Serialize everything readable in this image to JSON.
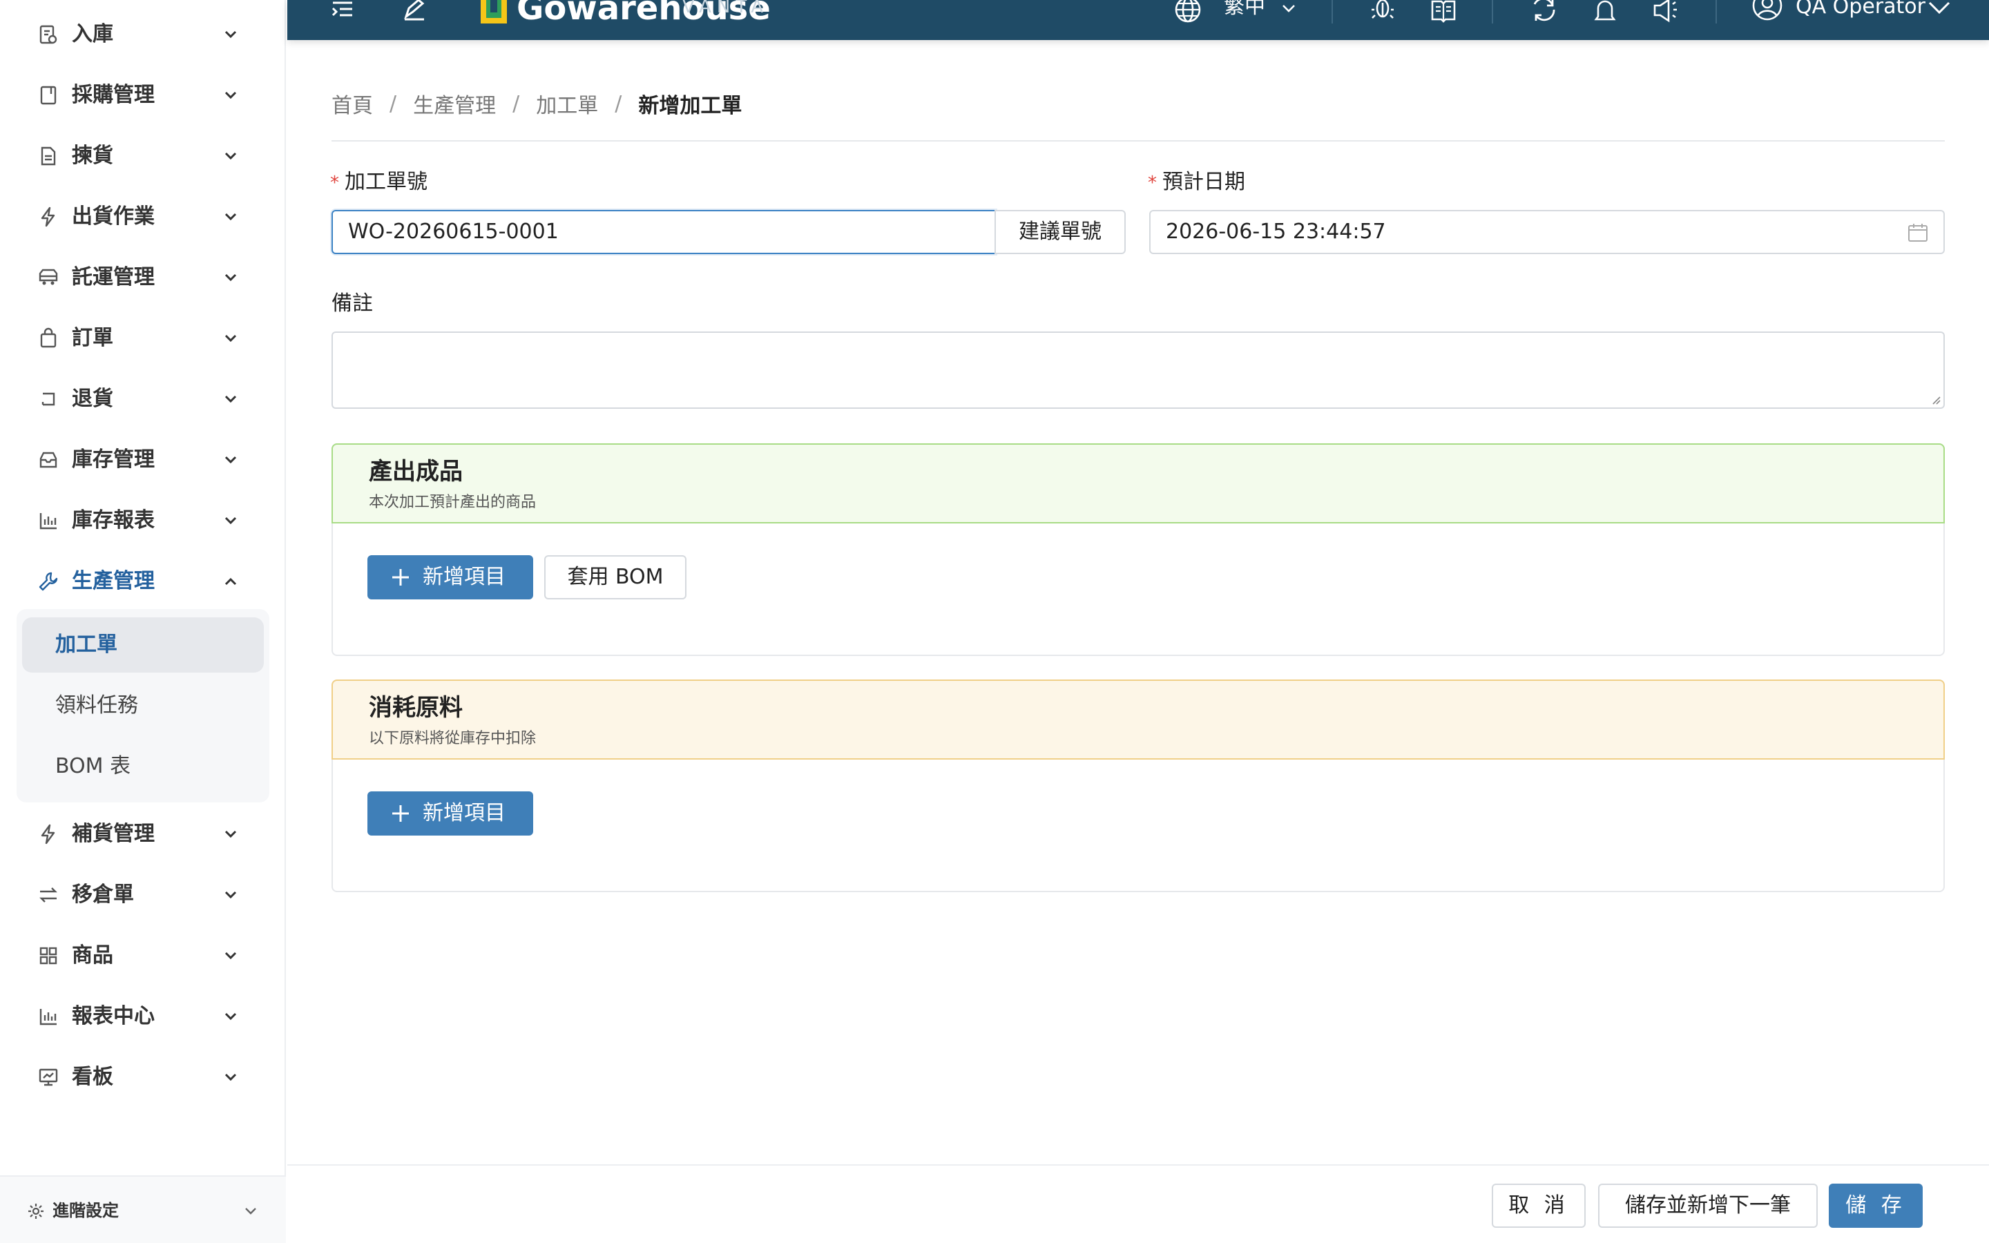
{
  "header": {
    "brand_name": "Gowarehouse",
    "brand_sub": "VANTA",
    "language": "繁中",
    "user": "QA Operator",
    "icons": [
      "menu-toggle-icon",
      "edit-icon",
      "globe-icon",
      "bug-icon",
      "book-icon",
      "refresh-icon",
      "bell-icon",
      "megaphone-icon",
      "user-icon"
    ]
  },
  "sidebar": {
    "items": [
      {
        "label": "入庫",
        "icon": "inbound-icon"
      },
      {
        "label": "採購管理",
        "icon": "purchase-icon"
      },
      {
        "label": "揀貨",
        "icon": "picking-icon"
      },
      {
        "label": "出貨作業",
        "icon": "lightning-icon"
      },
      {
        "label": "託運管理",
        "icon": "truck-icon"
      },
      {
        "label": "訂單",
        "icon": "bag-icon"
      },
      {
        "label": "退貨",
        "icon": "return-icon"
      },
      {
        "label": "庫存管理",
        "icon": "inbox-icon"
      },
      {
        "label": "庫存報表",
        "icon": "bar-chart-icon"
      },
      {
        "label": "生產管理",
        "icon": "wrench-icon"
      },
      {
        "label": "補貨管理",
        "icon": "lightning-icon"
      },
      {
        "label": "移倉單",
        "icon": "transfer-icon"
      },
      {
        "label": "商品",
        "icon": "grid-icon"
      },
      {
        "label": "報表中心",
        "icon": "bar-chart-icon"
      },
      {
        "label": "看板",
        "icon": "dashboard-icon"
      }
    ],
    "submenu": [
      {
        "label": "加工單"
      },
      {
        "label": "領料任務"
      },
      {
        "label": "BOM 表"
      }
    ],
    "footer_label": "進階設定"
  },
  "breadcrumb": {
    "items": [
      "首頁",
      "生產管理",
      "加工單"
    ],
    "current": "新增加工單",
    "separator": "/"
  },
  "form": {
    "order_no_label": "加工單號",
    "order_no_value": "WO-20260615-0001",
    "suggest_button": "建議單號",
    "date_label": "預計日期",
    "date_value": "2026-06-15 23:44:57",
    "remark_label": "備註",
    "required_mark": "*"
  },
  "output_card": {
    "title": "產出成品",
    "subtitle": "本次加工預計產出的商品",
    "add_button": "新增項目",
    "bom_button": "套用 BOM"
  },
  "material_card": {
    "title": "消耗原料",
    "subtitle": "以下原料將從庫存中扣除",
    "add_button": "新增項目"
  },
  "footer": {
    "cancel": "取 消",
    "save_next": "儲存並新增下一筆",
    "save": "儲 存"
  },
  "colors": {
    "header_bg": "#1f4b66",
    "primary": "#3f7fb8",
    "active_text": "#24619e",
    "required": "#e0443d",
    "output_card_bg": "#f3fbec",
    "material_card_bg": "#fdf6e7"
  }
}
